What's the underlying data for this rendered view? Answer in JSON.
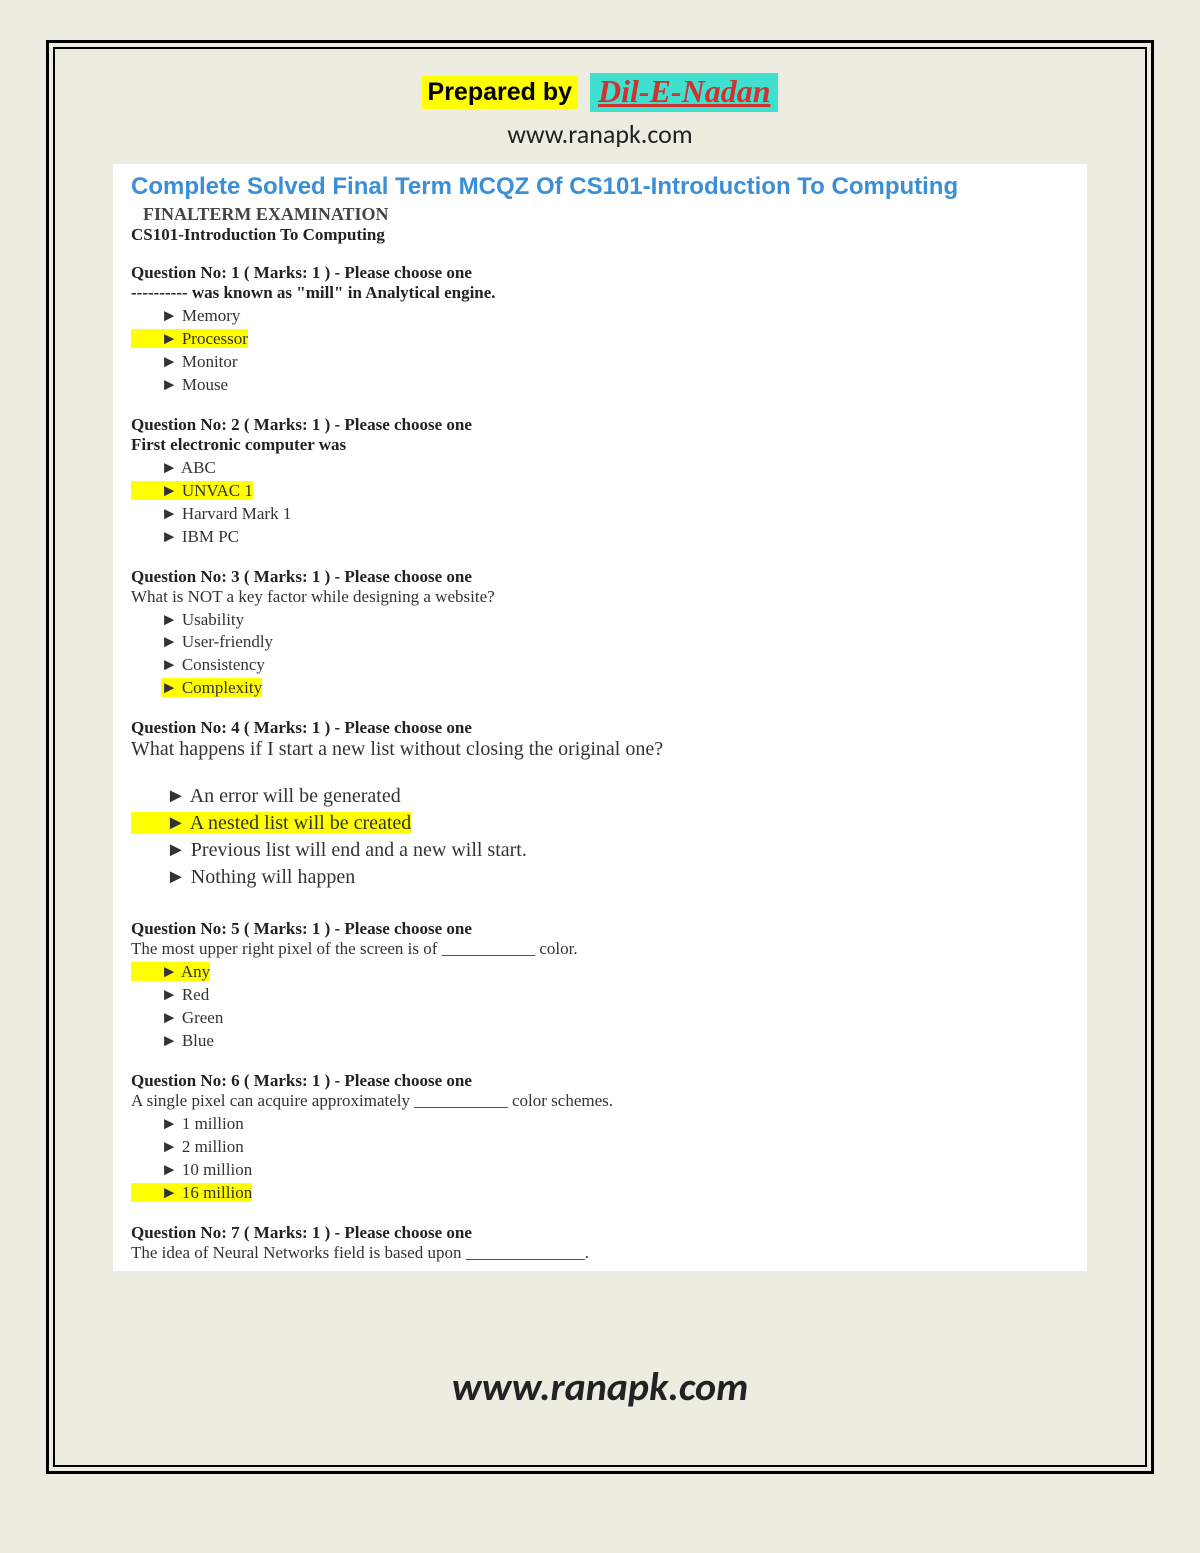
{
  "header": {
    "prepared_by_label": "Prepared by",
    "author": "Dil-E-Nadan",
    "site_url": "www.ranapk.com"
  },
  "title": "Complete Solved Final Term MCQZ Of CS101-Introduction To Computing",
  "exam_heading": "FINALTERM EXAMINATION",
  "course_line": "CS101-Introduction To Computing",
  "questions": [
    {
      "header": "Question No: 1    ( Marks: 1 )    - Please choose one",
      "text": " ---------- was known as \"mill\" in Analytical engine.",
      "text_style": "bold",
      "options": [
        {
          "text": "Memory",
          "correct": false,
          "lead_hl": false
        },
        {
          "text": "Processor",
          "correct": true,
          "lead_hl": true
        },
        {
          "text": "Monitor",
          "correct": false,
          "lead_hl": false
        },
        {
          "text": "Mouse",
          "correct": false,
          "lead_hl": false
        }
      ],
      "opt_style": "small"
    },
    {
      "header": "Question No: 2    ( Marks: 1 )    - Please choose one",
      "text": "First electronic computer was",
      "text_style": "bold",
      "options": [
        {
          "text": "ABC",
          "correct": false,
          "lead_hl": false
        },
        {
          "text": "UNVAC 1",
          "correct": true,
          "lead_hl": true
        },
        {
          "text": "Harvard Mark 1",
          "correct": false,
          "lead_hl": false
        },
        {
          "text": "IBM PC",
          "correct": false,
          "lead_hl": false
        }
      ],
      "opt_style": "small"
    },
    {
      "header": "Question No: 3    ( Marks: 1 )    - Please choose one",
      "text": " What is NOT a key factor while designing a website?",
      "text_style": "normal",
      "options": [
        {
          "text": "Usability",
          "correct": false,
          "lead_hl": false
        },
        {
          "text": "User-friendly",
          "correct": false,
          "lead_hl": false
        },
        {
          "text": "Consistency",
          "correct": false,
          "lead_hl": false
        },
        {
          "text": "Complexity",
          "correct": true,
          "lead_hl": false
        }
      ],
      "opt_style": "small"
    },
    {
      "header": "Question No: 4    ( Marks: 1 )    - Please choose one",
      "text": "What happens if I start a new list without closing the original one?",
      "text_style": "large",
      "pre_blank": true,
      "options": [
        {
          "text": "An error will be generated",
          "correct": false,
          "lead_hl": false
        },
        {
          "text": "A nested list will be created",
          "correct": true,
          "lead_hl": true
        },
        {
          "text": "Previous list will end and a new will start.",
          "correct": false,
          "lead_hl": false
        },
        {
          "text": "Nothing will happen",
          "correct": false,
          "lead_hl": false
        }
      ],
      "opt_style": "large",
      "extra_gap_after": true
    },
    {
      "header": "Question No: 5    ( Marks: 1 )    - Please choose one",
      "text": "The most upper right pixel of the screen is of ___________ color.",
      "text_style": "normal",
      "options": [
        {
          "text": "Any",
          "correct": true,
          "lead_hl": true
        },
        {
          "text": "Red",
          "correct": false,
          "lead_hl": false
        },
        {
          "text": "Green",
          "correct": false,
          "lead_hl": false
        },
        {
          "text": "Blue",
          "correct": false,
          "lead_hl": false
        }
      ],
      "opt_style": "small"
    },
    {
      "header": "Question No: 6    ( Marks: 1 )    - Please choose one",
      "text": " A single pixel can acquire approximately ___________ color schemes.",
      "text_style": "normal",
      "options": [
        {
          "text": "1 million",
          "correct": false,
          "lead_hl": false
        },
        {
          "text": "2 million",
          "correct": false,
          "lead_hl": false
        },
        {
          "text": "10 million",
          "correct": false,
          "lead_hl": false
        },
        {
          "text": "16 million",
          "correct": true,
          "lead_hl": true
        }
      ],
      "opt_style": "small"
    },
    {
      "header": "Question No: 7    ( Marks: 1 )    - Please choose one",
      "text": "The idea of Neural Networks field is based upon ______________.",
      "text_style": "normal",
      "options": [],
      "opt_style": "small"
    }
  ],
  "footer_url": "www.ranapk.com"
}
